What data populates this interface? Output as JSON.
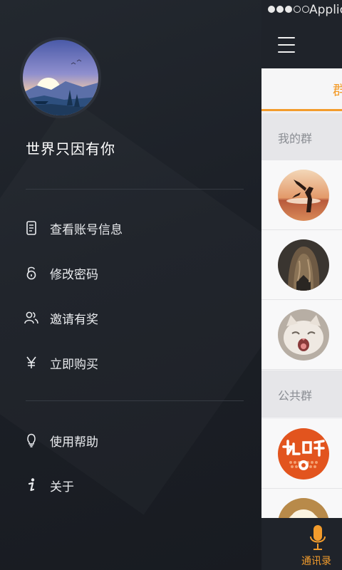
{
  "status_bar": {
    "carrier": "Applic",
    "signal_dots": [
      "on",
      "on",
      "on",
      "off",
      "off"
    ]
  },
  "drawer": {
    "username": "世界只因有你",
    "menu": [
      {
        "label": "查看账号信息",
        "icon": "document-icon"
      },
      {
        "label": "修改密码",
        "icon": "lock-icon"
      },
      {
        "label": "邀请有奖",
        "icon": "people-icon"
      },
      {
        "label": "立即购买",
        "icon": "yen-icon"
      }
    ],
    "menu_secondary": [
      {
        "label": "使用帮助",
        "icon": "lightbulb-icon"
      },
      {
        "label": "关于",
        "icon": "info-icon"
      }
    ]
  },
  "main": {
    "tab_label": "群",
    "sections": [
      {
        "title": "我的群"
      },
      {
        "title": "公共群"
      }
    ],
    "bottom_tab": {
      "label": "通讯录",
      "icon": "microphone-icon"
    }
  },
  "colors": {
    "accent": "#f39c2c",
    "drawer_bg": "#1c2027",
    "main_bg": "#f1f1f3",
    "text_light": "#e9ebee"
  }
}
